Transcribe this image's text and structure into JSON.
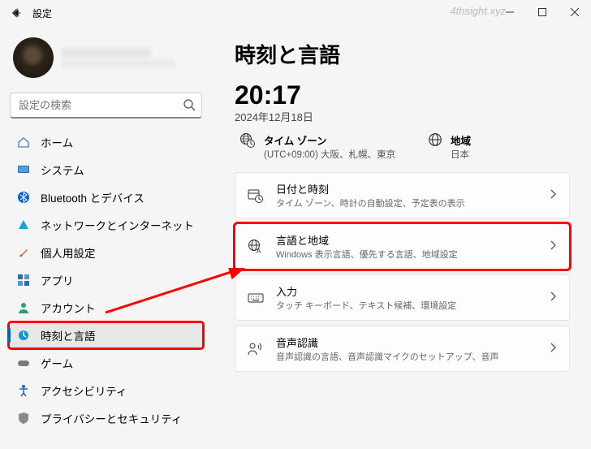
{
  "window": {
    "title": "設定",
    "watermark": "4thsight.xyz"
  },
  "search": {
    "placeholder": "設定の検索"
  },
  "nav": {
    "items": [
      {
        "label": "ホーム"
      },
      {
        "label": "システム"
      },
      {
        "label": "Bluetooth とデバイス"
      },
      {
        "label": "ネットワークとインターネット"
      },
      {
        "label": "個人用設定"
      },
      {
        "label": "アプリ"
      },
      {
        "label": "アカウント"
      },
      {
        "label": "時刻と言語"
      },
      {
        "label": "ゲーム"
      },
      {
        "label": "アクセシビリティ"
      },
      {
        "label": "プライバシーとセキュリティ"
      }
    ]
  },
  "page": {
    "heading": "時刻と言語",
    "time": "20:17",
    "date": "2024年12月18日",
    "timezone": {
      "label": "タイム ゾーン",
      "value": "(UTC+09:00) 大阪、札幌、東京"
    },
    "region": {
      "label": "地域",
      "value": "日本"
    },
    "cards": [
      {
        "title": "日付と時刻",
        "sub": "タイム ゾーン、時計の自動設定、予定表の表示"
      },
      {
        "title": "言語と地域",
        "sub": "Windows 表示言語、優先する言語、地域設定"
      },
      {
        "title": "入力",
        "sub": "タッチ キーボード、テキスト候補、環境設定"
      },
      {
        "title": "音声認識",
        "sub": "音声認識の言語、音声認識マイクのセットアップ、音声"
      }
    ]
  }
}
